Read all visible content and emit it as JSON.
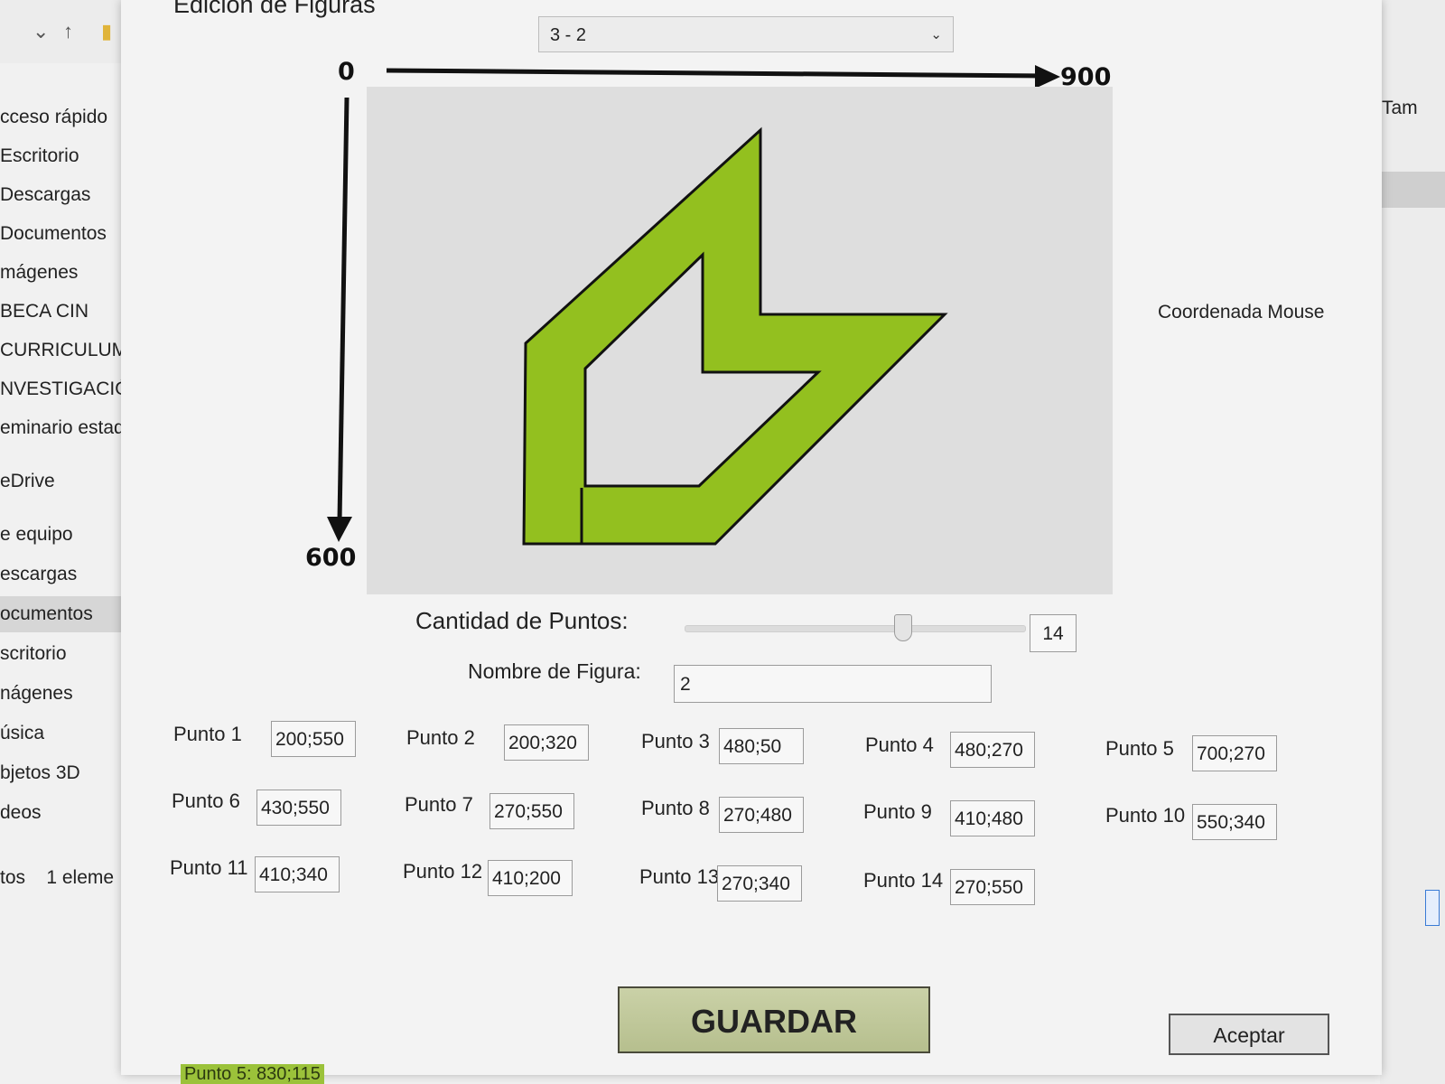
{
  "explorer": {
    "sidebar": [
      {
        "label": "cceso rápido"
      },
      {
        "label": "Escritorio"
      },
      {
        "label": "Descargas"
      },
      {
        "label": "Documentos"
      },
      {
        "label": "mágenes"
      },
      {
        "label": "BECA CIN"
      },
      {
        "label": "CURRICULUM"
      },
      {
        "label": "NVESTIGACIÓN"
      },
      {
        "label": "eminario estadí"
      },
      {
        "label": "eDrive"
      },
      {
        "label": "e equipo"
      },
      {
        "label": "escargas"
      },
      {
        "label": "ocumentos"
      },
      {
        "label": "scritorio"
      },
      {
        "label": "nágenes"
      },
      {
        "label": "úsica"
      },
      {
        "label": "bjetos 3D"
      },
      {
        "label": "deos"
      }
    ],
    "status": "tos    1 eleme",
    "right_column": "Tam"
  },
  "dialog": {
    "title": "Edición de Figuras",
    "shape_select": "3 - 2",
    "axis": {
      "origin": "0",
      "x_max": "900",
      "y_max": "600"
    },
    "mouse_label": "Coordenada Mouse",
    "quantity_label": "Cantidad de Puntos:",
    "quantity_value": "14",
    "quantity_slider_fraction": 0.64,
    "name_label": "Nombre de Figura:",
    "name_value": "2",
    "points": [
      {
        "label": "Punto 1",
        "value": "200;550"
      },
      {
        "label": "Punto 2",
        "value": "200;320"
      },
      {
        "label": "Punto 3",
        "value": "480;50"
      },
      {
        "label": "Punto 4",
        "value": "480;270"
      },
      {
        "label": "Punto 5",
        "value": "700;270"
      },
      {
        "label": "Punto 6",
        "value": "430;550"
      },
      {
        "label": "Punto 7",
        "value": "270;550"
      },
      {
        "label": "Punto 8",
        "value": "270;480"
      },
      {
        "label": "Punto 9",
        "value": "410;480"
      },
      {
        "label": "Punto 10",
        "value": "550;340"
      },
      {
        "label": "Punto 11",
        "value": "410;340"
      },
      {
        "label": "Punto 12",
        "value": "410;200"
      },
      {
        "label": "Punto 13",
        "value": "270;340"
      },
      {
        "label": "Punto 14",
        "value": "270;550"
      }
    ],
    "save_label": "GUARDAR",
    "accept_label": "Aceptar",
    "status": "Punto 5: 830;115",
    "shape_fill": "#93c01f",
    "shape_stroke": "#111111"
  }
}
